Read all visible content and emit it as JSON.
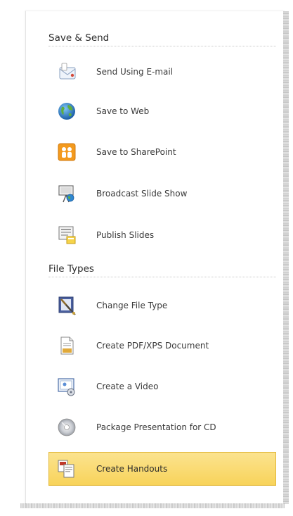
{
  "save_send": {
    "header": "Save & Send",
    "items": [
      {
        "label": "Send Using E-mail",
        "icon": "email-icon"
      },
      {
        "label": "Save to Web",
        "icon": "globe-icon"
      },
      {
        "label": "Save to SharePoint",
        "icon": "sharepoint-icon"
      },
      {
        "label": "Broadcast Slide Show",
        "icon": "broadcast-icon"
      },
      {
        "label": "Publish Slides",
        "icon": "publish-slides-icon"
      }
    ]
  },
  "file_types": {
    "header": "File Types",
    "items": [
      {
        "label": "Change File Type",
        "icon": "change-file-type-icon"
      },
      {
        "label": "Create PDF/XPS Document",
        "icon": "pdf-xps-icon"
      },
      {
        "label": "Create a Video",
        "icon": "video-icon"
      },
      {
        "label": "Package Presentation for CD",
        "icon": "cd-icon"
      },
      {
        "label": "Create Handouts",
        "icon": "handouts-icon",
        "selected": true
      }
    ]
  },
  "colors": {
    "selected_bg": "#f8d35a",
    "selected_border": "#e2b83a",
    "text": "#3a3a3a"
  }
}
